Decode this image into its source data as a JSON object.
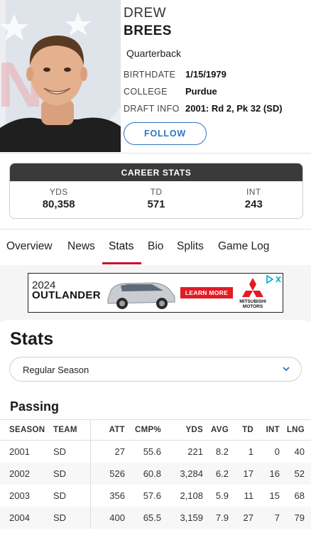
{
  "player": {
    "first_name": "DREW",
    "last_name": "BREES",
    "position": "Quarterback",
    "info": [
      {
        "label": "BIRTHDATE",
        "value": "1/15/1979"
      },
      {
        "label": "COLLEGE",
        "value": "Purdue"
      },
      {
        "label": "DRAFT INFO",
        "value": "2001: Rd 2, Pk 32 (SD)"
      }
    ],
    "follow_label": "FOLLOW"
  },
  "career": {
    "title": "CAREER STATS",
    "stats": [
      {
        "label": "YDS",
        "value": "80,358"
      },
      {
        "label": "TD",
        "value": "571"
      },
      {
        "label": "INT",
        "value": "243"
      }
    ]
  },
  "tabs": [
    "Overview",
    "News",
    "Stats",
    "Bio",
    "Splits",
    "Game Log"
  ],
  "active_tab": "Stats",
  "ad": {
    "year": "2024",
    "model": "OUTLANDER",
    "cta": "LEARN MORE",
    "brand_line1": "MITSUBISHI",
    "brand_line2": "MOTORS"
  },
  "stats_section": {
    "title": "Stats",
    "season_select": "Regular Season",
    "table_title": "Passing",
    "columns": [
      "SEASON",
      "TEAM",
      "ATT",
      "CMP%",
      "YDS",
      "AVG",
      "TD",
      "INT",
      "LNG"
    ],
    "rows": [
      [
        "2001",
        "SD",
        "27",
        "55.6",
        "221",
        "8.2",
        "1",
        "0",
        "40"
      ],
      [
        "2002",
        "SD",
        "526",
        "60.8",
        "3,284",
        "6.2",
        "17",
        "16",
        "52"
      ],
      [
        "2003",
        "SD",
        "356",
        "57.6",
        "2,108",
        "5.9",
        "11",
        "15",
        "68"
      ],
      [
        "2004",
        "SD",
        "400",
        "65.5",
        "3,159",
        "7.9",
        "27",
        "7",
        "79"
      ]
    ]
  },
  "colors": {
    "accent_red": "#c8102e",
    "follow_blue": "#2f74c0",
    "career_header": "#3a3a3a",
    "mitsubishi_red": "#e31b23"
  }
}
